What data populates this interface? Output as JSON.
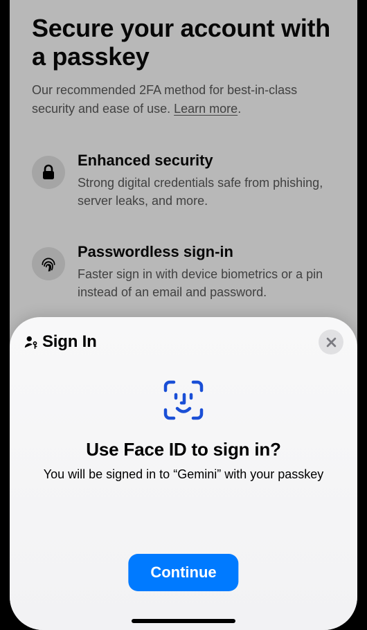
{
  "page": {
    "title": "Secure your account with a passkey",
    "subtitle": "Our recommended 2FA method for best-in-class security and ease of use. ",
    "learnMore": "Learn more",
    "features": [
      {
        "icon": "lock-icon",
        "title": "Enhanced security",
        "desc": "Strong digital credentials safe from phishing, server leaks, and more."
      },
      {
        "icon": "fingerprint-icon",
        "title": "Passwordless sign-in",
        "desc": "Faster sign in with device biometrics or a pin instead of an email and password."
      }
    ]
  },
  "sheet": {
    "header": "Sign In",
    "title": "Use Face ID to sign in?",
    "desc": "You will be signed in to “Gemini” with your passkey",
    "continue": "Continue"
  }
}
